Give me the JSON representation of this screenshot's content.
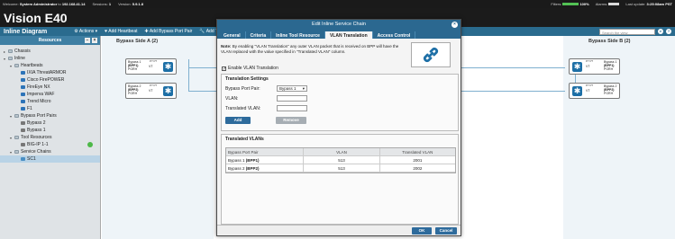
{
  "topbar": {
    "welcome": "Welcome:",
    "user": "System Administrator",
    "to_label": "to",
    "ip": "192.168.41.14",
    "sessions_label": "Sessions:",
    "sessions": "1",
    "version_label": "Version:",
    "version": "5.9.1.8",
    "filters_label": "Filters:",
    "filters_value": "100%",
    "filters_fill": 1.0,
    "alarms_label": "Alarms:",
    "last_update_label": "Last update:",
    "last_update": "3:25:08am PST"
  },
  "title": "Vision E40",
  "toolbar": {
    "app_name": "Inline Diagram",
    "actions": "Actions",
    "add_heartbeat": "Add Heartbeat",
    "add_bypass_port_pair": "Add Bypass Port Pair",
    "add_tool": "Add Too",
    "search_placeholder": "Search the view"
  },
  "sidebar": {
    "title": "Resources",
    "items": [
      {
        "label": "Chassis",
        "level": 0,
        "glyph": "▸",
        "icon": "folder"
      },
      {
        "label": "Inline",
        "level": 0,
        "glyph": "▾",
        "icon": "folder"
      },
      {
        "label": "Heartbeats",
        "level": 1,
        "glyph": "▾",
        "icon": "folder"
      },
      {
        "label": "IXIA ThreatARMOR",
        "level": 2,
        "glyph": "",
        "icon": "gem"
      },
      {
        "label": "Cisco FirePOWER",
        "level": 2,
        "glyph": "",
        "icon": "gem"
      },
      {
        "label": "FireEye NX",
        "level": 2,
        "glyph": "",
        "icon": "gem"
      },
      {
        "label": "Imperva WAF",
        "level": 2,
        "glyph": "",
        "icon": "gem"
      },
      {
        "label": "Trend Micro",
        "level": 2,
        "glyph": "",
        "icon": "gem"
      },
      {
        "label": "F1",
        "level": 2,
        "glyph": "",
        "icon": "gem"
      },
      {
        "label": "Bypass Port Pairs",
        "level": 1,
        "glyph": "▾",
        "icon": "folder"
      },
      {
        "label": "Bypass 2",
        "level": 2,
        "glyph": "",
        "icon": "gear"
      },
      {
        "label": "Bypass 1",
        "level": 2,
        "glyph": "",
        "icon": "gear"
      },
      {
        "label": "Tool Resources",
        "level": 1,
        "glyph": "▾",
        "icon": "folder"
      },
      {
        "label": "BIG-IP 1-1",
        "level": 2,
        "glyph": "",
        "icon": "gear"
      },
      {
        "label": "Service Chains",
        "level": 1,
        "glyph": "▾",
        "icon": "folder"
      },
      {
        "label": "SC1",
        "level": 2,
        "glyph": "",
        "icon": "chain"
      }
    ]
  },
  "diagram": {
    "side_a_label": "Bypass Side A",
    "side_a_count": "(2)",
    "side_b_label": "Bypass Side B",
    "side_b_count": "(2)",
    "ports_a": [
      {
        "line1": "Bypass 1",
        "line2": "(BPP1)",
        "line3": "PGRH",
        "pins": "P? P?",
        "vt": "VT"
      },
      {
        "line1": "Bypass 2",
        "line2": "(BPP2)",
        "line3": "PGRH",
        "pins": "P? P?",
        "vt": "VT"
      }
    ],
    "ports_b": [
      {
        "line1": "Bypass 1",
        "line2": "(BPP1)",
        "line3": "PGRH",
        "pins": "P? P?",
        "vt": "VT"
      },
      {
        "line1": "Bypass 2",
        "line2": "(BPP2)",
        "line3": "PGRH",
        "pins": "P? P?",
        "vt": "VT"
      }
    ]
  },
  "modal": {
    "title": "Edit Inline Service Chain",
    "tabs": [
      "General",
      "Criteria",
      "Inline Tool Resource",
      "VLAN Translation",
      "Access Control"
    ],
    "active_tab": 3,
    "note_bold": "Note:",
    "note_text": "By enabling \"VLAN Translation\" any outer VLAN packet that is received on BPP will have the VLAN replaced with the value specified in \"Translated VLAN\" column.",
    "enable_label": "Enable VLAN Translation",
    "enable_checked": "✓",
    "settings_title": "Translation Settings",
    "bypass_port_pair_label": "Bypass Port Pair:",
    "bypass_port_pair_value": "Bypass 1",
    "vlan_label": "VLAN:",
    "translated_vlan_label": "Translated VLAN:",
    "add_button": "Add",
    "remove_button": "Remove",
    "table_title": "Translated VLANs",
    "columns": [
      "Bypass Port Pair",
      "VLAN",
      "Translated VLAN"
    ],
    "rows": [
      {
        "pair": "Bypass 1",
        "pair_code": "(BPP1)",
        "vlan": "513",
        "translated": "2001"
      },
      {
        "pair": "Bypass 2",
        "pair_code": "(BPP2)",
        "vlan": "513",
        "translated": "2002"
      }
    ],
    "ok_button": "OK",
    "cancel_button": "Cancel"
  }
}
